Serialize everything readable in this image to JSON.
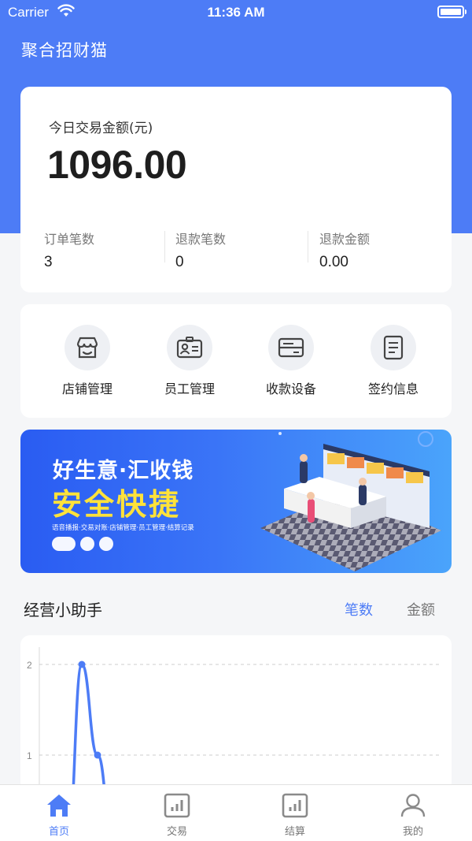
{
  "status_bar": {
    "carrier": "Carrier",
    "time": "11:36 AM"
  },
  "app_title": "聚合招财猫",
  "summary": {
    "label": "今日交易金额(元)",
    "amount": "1096.00",
    "stats": [
      {
        "label": "订单笔数",
        "value": "3"
      },
      {
        "label": "退款笔数",
        "value": "0"
      },
      {
        "label": "退款金额",
        "value": "0.00"
      }
    ]
  },
  "menu": [
    {
      "label": "店铺管理",
      "icon": "store-icon"
    },
    {
      "label": "员工管理",
      "icon": "id-card-icon"
    },
    {
      "label": "收款设备",
      "icon": "device-icon"
    },
    {
      "label": "签约信息",
      "icon": "document-icon"
    }
  ],
  "banner": {
    "line1": "好生意·汇收钱",
    "line2": "安全快捷",
    "line3": "语音播报·交易对账·店铺管理·员工管理·结算记录"
  },
  "assistant": {
    "title": "经营小助手",
    "tabs": [
      "笔数",
      "金额"
    ],
    "active_tab": "笔数"
  },
  "chart_data": {
    "type": "line",
    "y_ticks": [
      "1",
      "2"
    ],
    "ylim": [
      0,
      2
    ],
    "series": [
      {
        "values": [
          0,
          2,
          1,
          0
        ]
      }
    ],
    "color": "#4d7cf6",
    "grid": true
  },
  "tabbar": [
    {
      "label": "首页",
      "icon": "home-icon",
      "active": true
    },
    {
      "label": "交易",
      "icon": "bar-chart-icon",
      "active": false
    },
    {
      "label": "结算",
      "icon": "bar-chart-icon",
      "active": false
    },
    {
      "label": "我的",
      "icon": "user-icon",
      "active": false
    }
  ],
  "colors": {
    "primary": "#4d7cf6",
    "accent_yellow": "#ffe23a"
  }
}
